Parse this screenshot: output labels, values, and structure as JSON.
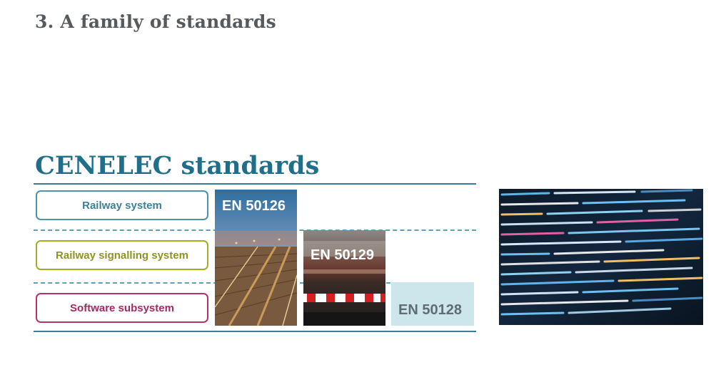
{
  "slide_title": "3. A family of standards",
  "section_title": "CENELEC standards",
  "pills": {
    "railway": "Railway system",
    "signalling": "Railway signalling system",
    "software": "Software subsystem"
  },
  "standards": {
    "en50126": "EN 50126",
    "en50129": "EN 50129",
    "en50128": "EN 50128"
  },
  "colors": {
    "title_gray": "#555a5e",
    "section_teal": "#1f6f8b",
    "railway_blue": "#4f91a8",
    "signalling_olive": "#a3ad2a",
    "software_magenta": "#b0336c",
    "en50128_block": "#cde6ec"
  },
  "icons": {
    "rail_photo": "railway-tracks-photo",
    "crossing_photo": "level-crossing-photo",
    "code_photo": "source-code-photo"
  }
}
